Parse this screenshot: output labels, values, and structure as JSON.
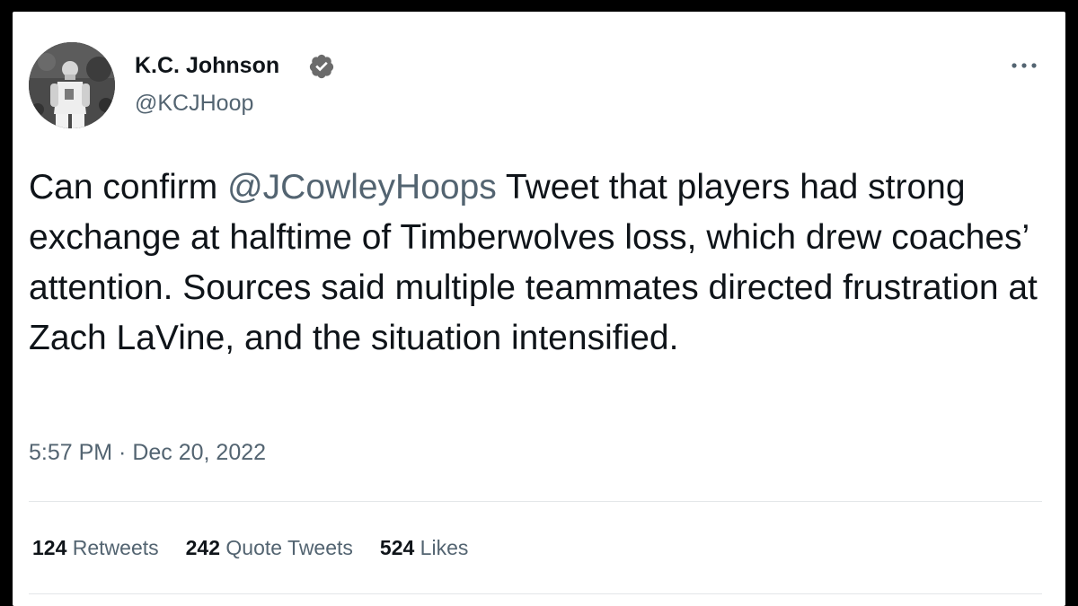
{
  "author": {
    "display_name": "K.C. Johnson",
    "handle": "@KCJHoop",
    "verified": true,
    "avatar_icon": "avatar-photo-icon"
  },
  "tweet": {
    "text_before_mention": "Can confirm ",
    "mention": "@JCowleyHoops",
    "text_after_mention": " Tweet that players had strong exchange at halftime of Timberwolves loss, which drew coaches’ attention. Sources said multiple teammates directed frustration at Zach LaVine, and the situation intensified.",
    "timestamp": "5:57 PM · Dec 20, 2022"
  },
  "stats": {
    "retweets_count": "124",
    "retweets_label": "Retweets",
    "quote_tweets_count": "242",
    "quote_tweets_label": "Quote Tweets",
    "likes_count": "524",
    "likes_label": "Likes"
  },
  "icons": {
    "more": "more-options-icon",
    "verified": "verified-badge-icon"
  },
  "colors": {
    "text_primary": "#0f1419",
    "text_secondary": "#536471",
    "divider": "#e3e6e8",
    "frame": "#000000",
    "card": "#ffffff"
  }
}
